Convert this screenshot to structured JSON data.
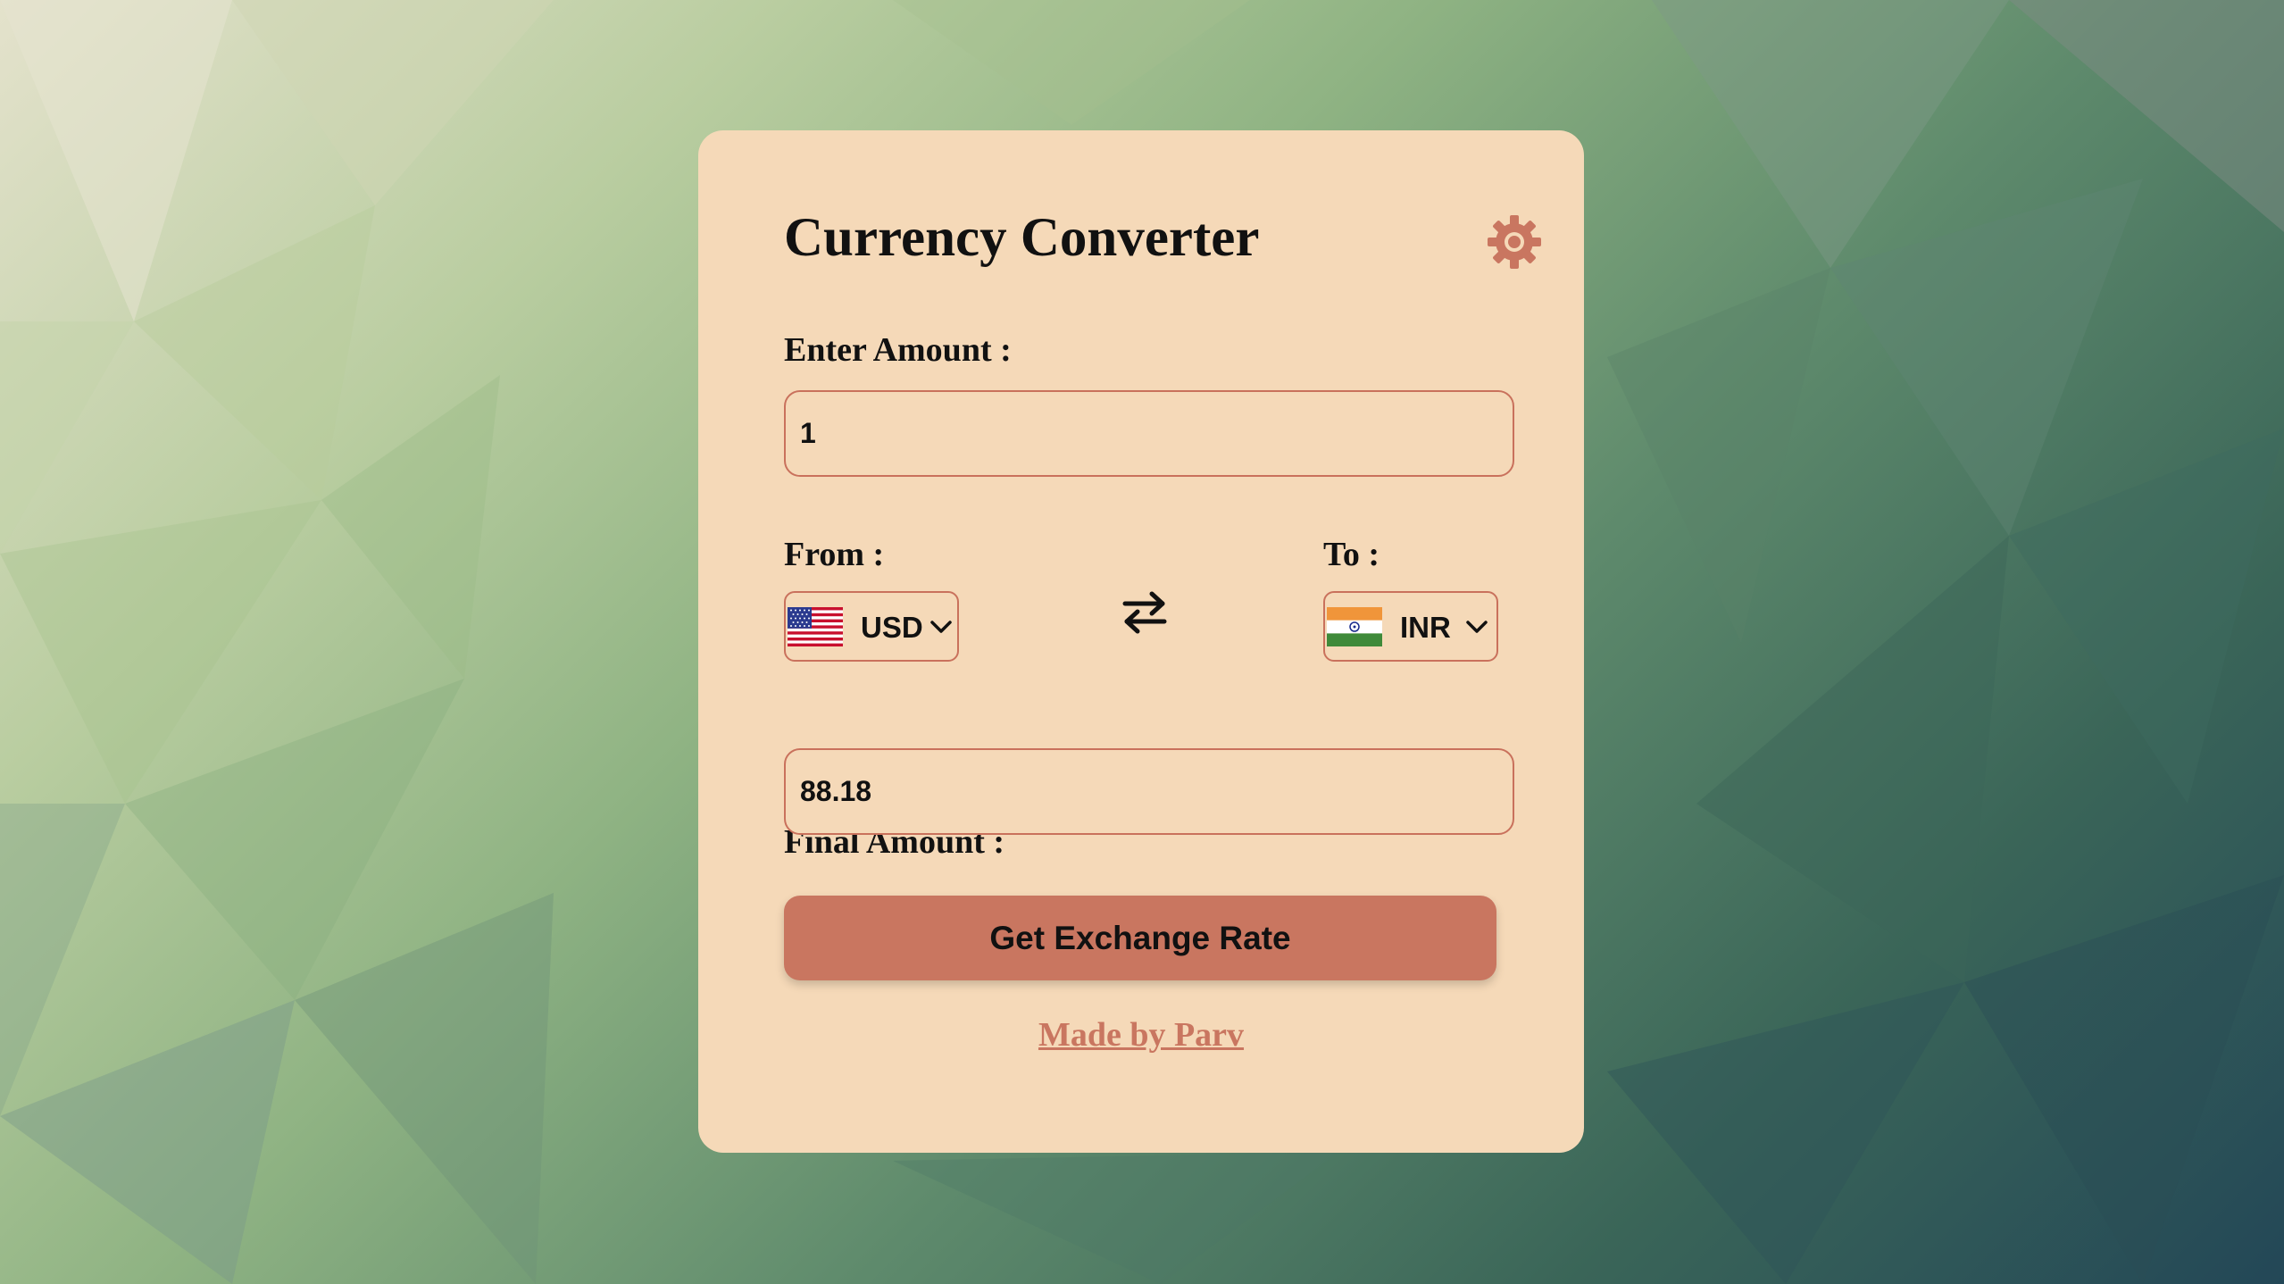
{
  "app": {
    "title": "Currency Converter",
    "theme_icon": "gear-icon"
  },
  "amount": {
    "label": "Enter Amount :",
    "value": "1"
  },
  "from": {
    "label": "From :",
    "currency": "USD",
    "flag_icon": "us-flag-icon"
  },
  "to": {
    "label": "To :",
    "currency": "INR",
    "flag_icon": "india-flag-icon"
  },
  "swap_icon": "swap-arrows-icon",
  "result": {
    "label": "Final Amount :",
    "value": "88.18"
  },
  "button": {
    "label": "Get Exchange Rate"
  },
  "footer": {
    "credit": "Made by Parv"
  },
  "colors": {
    "card_background": "#f5d9b8",
    "accent": "#c97660",
    "border": "#c9715c",
    "text": "#111111"
  }
}
